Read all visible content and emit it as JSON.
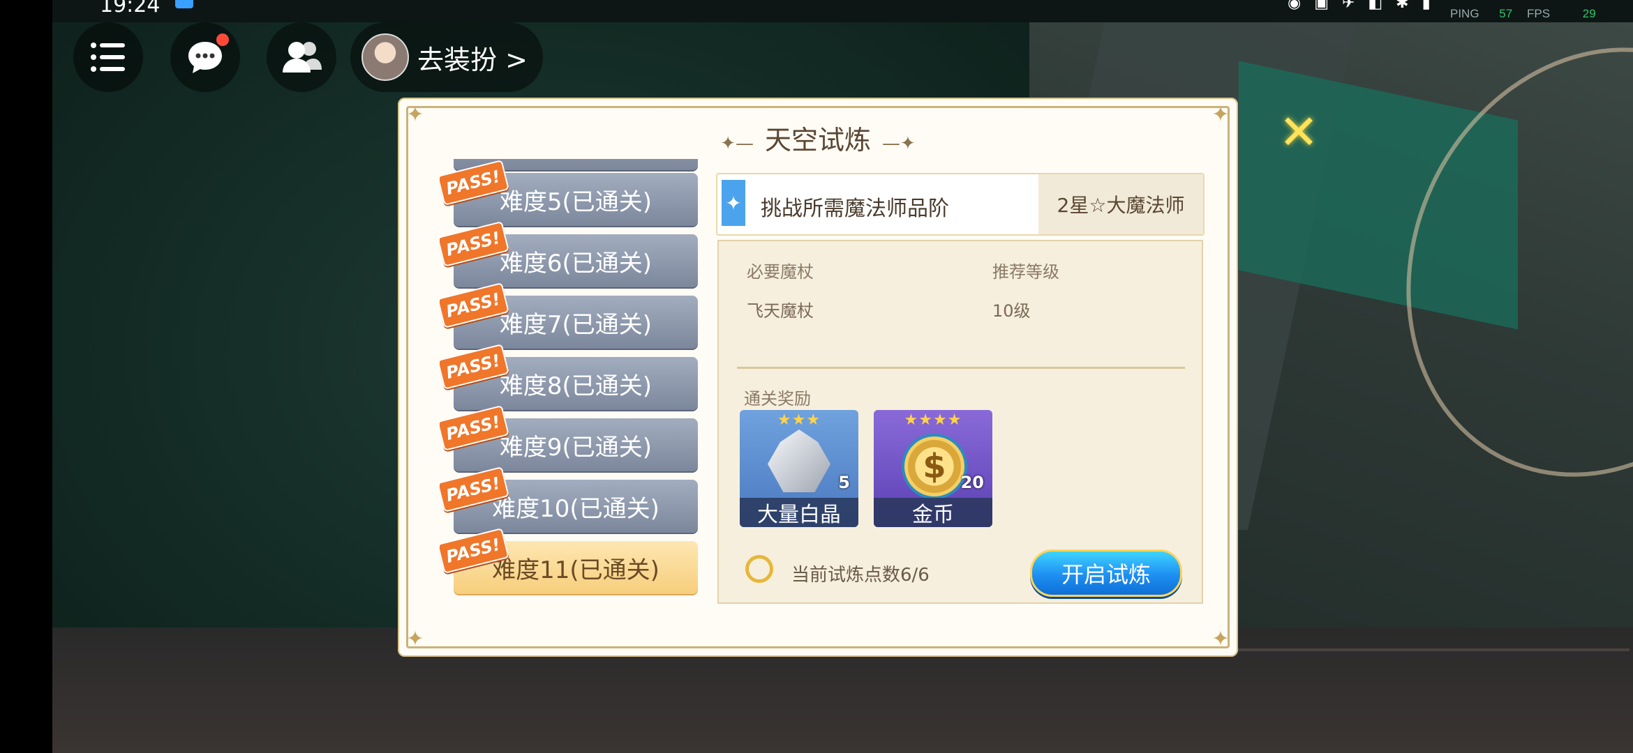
{
  "status": {
    "time": "19:24",
    "perf": {
      "ping_label": "PING",
      "ping_value": "57",
      "fps_label": "FPS",
      "fps_value": "29"
    }
  },
  "topbar": {
    "dress_label": "去装扮 >"
  },
  "dialog": {
    "title": "天空试炼",
    "levels": [
      {
        "pass": "PASS!",
        "label": "难度5(已通关)",
        "selected": false
      },
      {
        "pass": "PASS!",
        "label": "难度6(已通关)",
        "selected": false
      },
      {
        "pass": "PASS!",
        "label": "难度7(已通关)",
        "selected": false
      },
      {
        "pass": "PASS!",
        "label": "难度8(已通关)",
        "selected": false
      },
      {
        "pass": "PASS!",
        "label": "难度9(已通关)",
        "selected": false
      },
      {
        "pass": "PASS!",
        "label": "难度10(已通关)",
        "selected": false
      },
      {
        "pass": "PASS!",
        "label": "难度11(已通关)",
        "selected": true
      }
    ],
    "requirement": {
      "label": "挑战所需魔法师品阶",
      "value": "2星☆大魔法师"
    },
    "details": {
      "wand_label": "必要魔杖",
      "wand_value": "飞天魔杖",
      "level_label": "推荐等级",
      "level_value": "10级"
    },
    "rewards_title": "通关奖励",
    "rewards": [
      {
        "name": "大量白晶",
        "count": "5",
        "stars": "★★★",
        "icon": "crystal-icon",
        "color": "#5d8fd0"
      },
      {
        "name": "金币",
        "count": "20",
        "stars": "★★★★",
        "icon": "coin-icon",
        "color": "#6a52c8"
      }
    ],
    "points_text": "当前试炼点数6/6",
    "start_label": "开启试炼"
  },
  "colors": {
    "accent": "#1e8ff2",
    "pass": "#f0762a",
    "frame": "#cbb27a"
  }
}
